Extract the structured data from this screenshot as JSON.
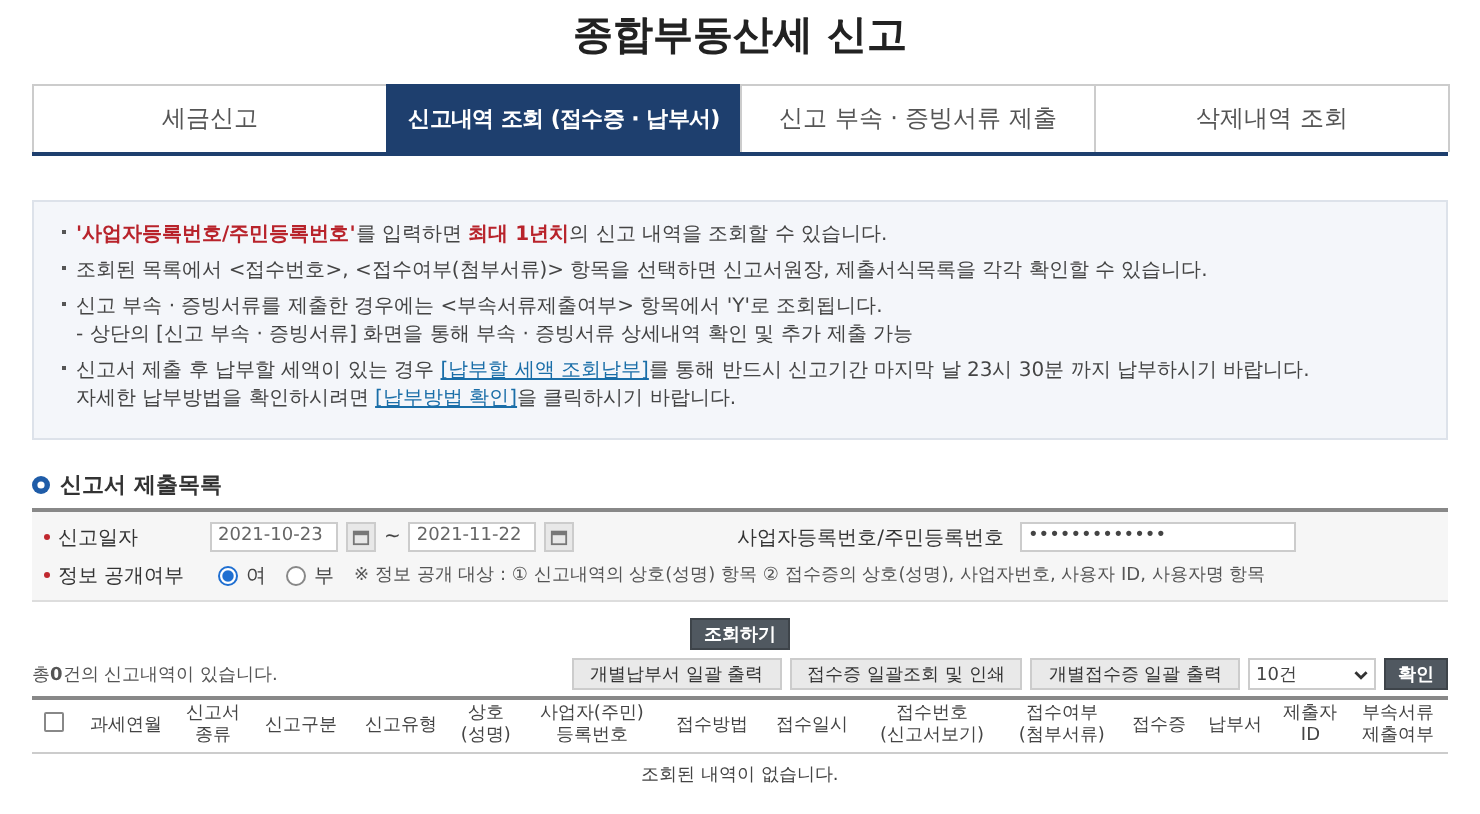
{
  "page_title": "종합부동산세 신고",
  "tabs": [
    {
      "label": "세금신고",
      "selected": false
    },
    {
      "label": "신고내역 조회 (접수증 · 납부서)",
      "selected": true
    },
    {
      "label": "신고 부속 · 증빙서류 제출",
      "selected": false
    },
    {
      "label": "삭제내역 조회",
      "selected": false
    }
  ],
  "notices": [
    {
      "lines": [
        [
          {
            "kind": "em",
            "text": "'사업자등록번호/주민등록번호'"
          },
          {
            "kind": "text",
            "text": "를 입력하면 "
          },
          {
            "kind": "em",
            "text": "최대 1년치"
          },
          {
            "kind": "text",
            "text": "의 신고 내역을 조회할 수 있습니다."
          }
        ]
      ]
    },
    {
      "lines": [
        [
          {
            "kind": "text",
            "text": "조회된 목록에서 <접수번호>, <접수여부(첨부서류)> 항목을 선택하면 신고서원장, 제출서식목록을 각각 확인할 수 있습니다."
          }
        ]
      ]
    },
    {
      "lines": [
        [
          {
            "kind": "text",
            "text": "신고 부속 · 증빙서류를 제출한 경우에는 <부속서류제출여부> 항목에서 'Y'로 조회됩니다."
          }
        ],
        [
          {
            "kind": "text",
            "text": "- 상단의 [신고 부속 · 증빙서류] 화면을 통해 부속 · 증빙서류 상세내역 확인 및 추가 제출 가능"
          }
        ]
      ]
    },
    {
      "lines": [
        [
          {
            "kind": "text",
            "text": "신고서 제출 후 납부할 세액이 있는 경우 "
          },
          {
            "kind": "link",
            "text": "[납부할 세액 조회납부]"
          },
          {
            "kind": "text",
            "text": "를 통해 반드시 신고기간 마지막 날 23시 30분 까지 납부하시기 바랍니다."
          }
        ],
        [
          {
            "kind": "text",
            "text": "자세한 납부방법을 확인하시려면 "
          },
          {
            "kind": "link",
            "text": "[납부방법 확인]"
          },
          {
            "kind": "text",
            "text": "을 클릭하시기 바랍니다."
          }
        ]
      ]
    }
  ],
  "section_title": "신고서 제출목록",
  "form": {
    "date_label": "신고일자",
    "date_from": "2021-10-23",
    "date_sep": "~",
    "date_to": "2021-11-22",
    "id_label": "사업자등록번호/주민등록번호",
    "id_value": "•••••••••••••",
    "disclosure_label": "정보 공개여부",
    "options": [
      {
        "label": "여",
        "selected": true
      },
      {
        "label": "부",
        "selected": false
      }
    ],
    "disclosure_note": "※ 정보 공개 대상 : ① 신고내역의 상호(성명) 항목 ② 접수증의 상호(성명), 사업자번호, 사용자 ID, 사용자명 항목"
  },
  "search_button": "조회하기",
  "result_count": "총**0**건의 신고내역이 있습니다.",
  "actions": [
    "개별납부서 일괄 출력",
    "접수증 일괄조회 및 인쇄",
    "개별접수증 일괄 출력"
  ],
  "page_size": "10건",
  "confirm_button": "확인",
  "table": {
    "select_all_checked": false,
    "columns": [
      "과세연월",
      "신고서\n종류",
      "신고구분",
      "신고유형",
      "상호\n(성명)",
      "사업자(주민)\n등록번호",
      "접수방법",
      "접수일시",
      "접수번호\n(신고서보기)",
      "접수여부\n(첨부서류)",
      "접수증",
      "납부서",
      "제출자\nID",
      "부속서류\n제출여부"
    ],
    "empty_message": "조회된 내역이 없습니다."
  }
}
